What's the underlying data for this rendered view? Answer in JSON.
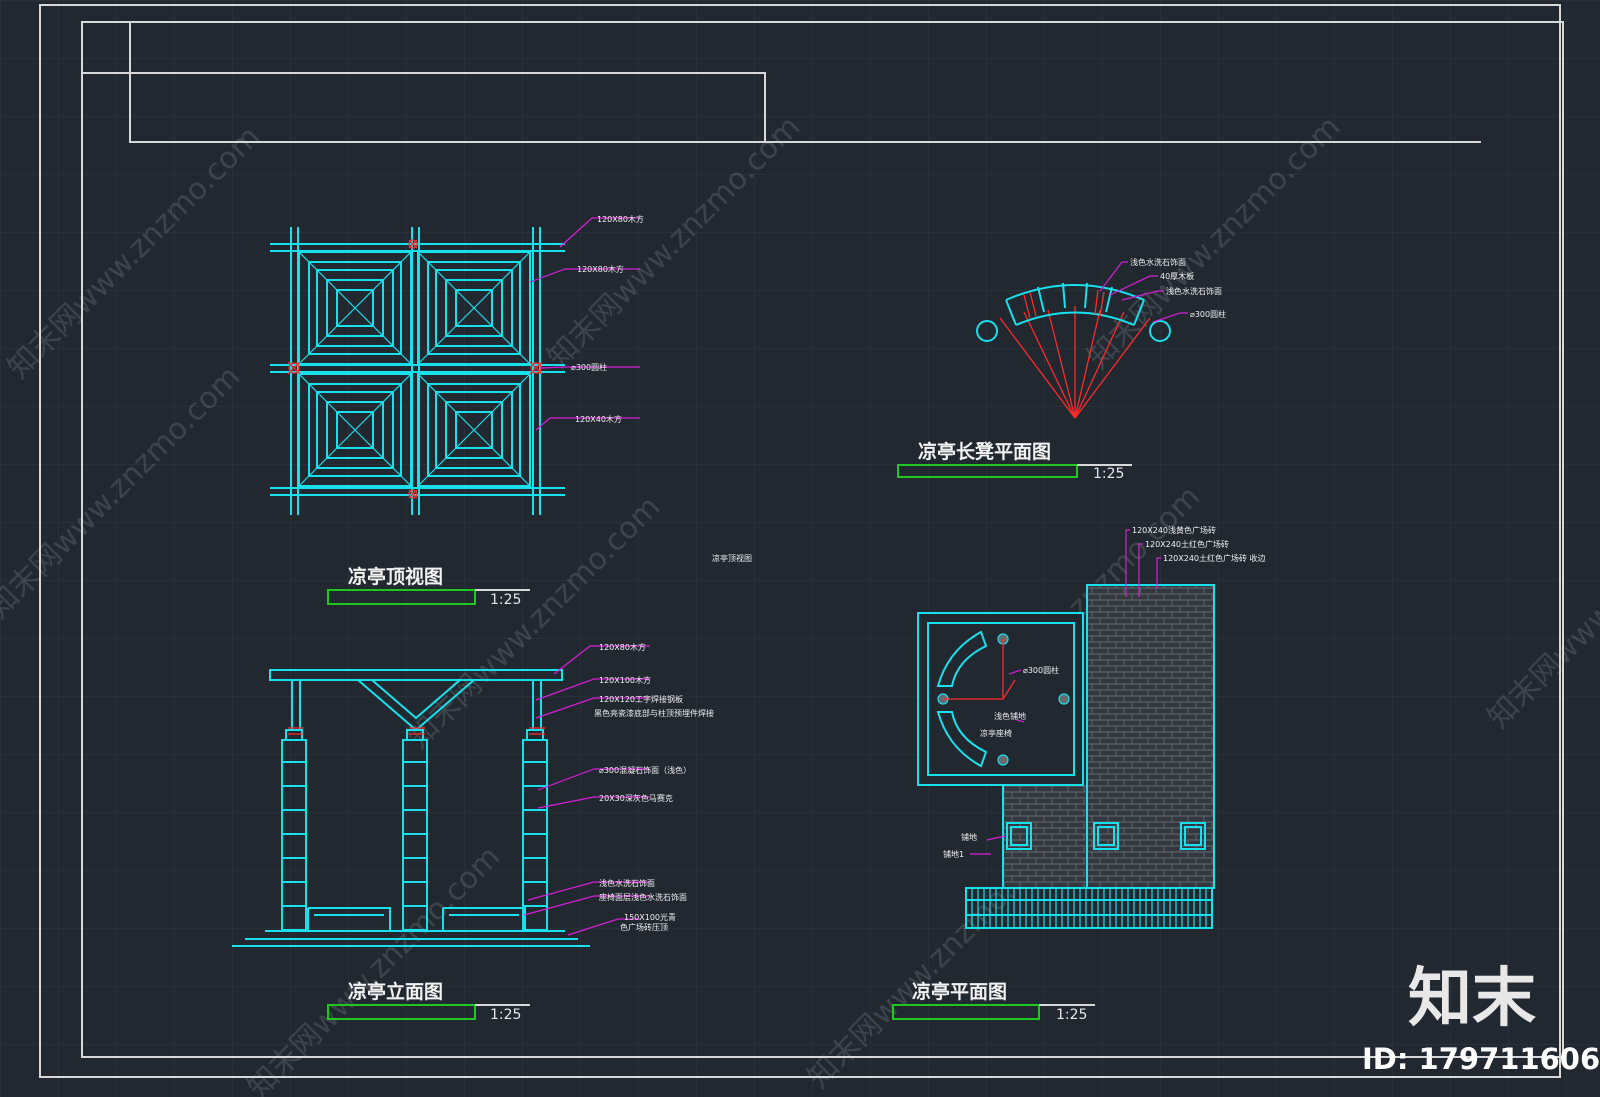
{
  "drawing": {
    "top_view": {
      "title": "凉亭顶视图",
      "scale": "1:25"
    },
    "bench_plan": {
      "title": "凉亭长凳平面图",
      "scale": "1:25"
    },
    "elevation": {
      "title": "凉亭立面图",
      "scale": "1:25"
    },
    "floor_plan": {
      "title": "凉亭平面图",
      "scale": "1:25"
    },
    "stray_label": "凉亭顶视图"
  },
  "annotations": {
    "top_view": [
      "120X80木方",
      "120X80木方",
      "⌀300圆柱",
      "120X40木方"
    ],
    "bench_plan": [
      "浅色水洗石饰面",
      "40厚木板",
      "浅色水洗石饰面",
      "⌀300圆柱"
    ],
    "elevation": [
      "120X80木方",
      "120X100木方",
      "120X120工字焊接钢板",
      "黑色亮瓷漆底部与柱顶预埋件焊接",
      "⌀300混凝石饰面（浅色）",
      "20X30深灰色马赛克",
      "浅色水洗石饰面",
      "座椅面层浅色水洗石饰面",
      "150X100光青",
      "色广场砖压顶"
    ],
    "floor_plan": [
      "120X240浅黄色广场砖",
      "120X240土红色广场砖",
      "120X240土红色广场砖 收边",
      "⌀300圆柱",
      "浅色铺地",
      "凉亭座椅",
      "铺地",
      "铺地1"
    ]
  },
  "brand": {
    "logo_text": "知末",
    "id_label": "ID: 179711606"
  },
  "watermarks": [
    "知末网www.znzmo.com",
    "知末网www.znzmo.com",
    "知末网www.znzmo.com",
    "知末网www.znzmo.com",
    "知末网www.znzmo.com",
    "知末网www.znzmo.com",
    "知末网www.znzmo.com",
    "知末网www.znzmo.com",
    "知末网www.znzmo.com"
  ],
  "colors": {
    "background": "#212830",
    "frame": "#d8d8d8",
    "cyan": "#18e0ec",
    "red": "#ff2a2a",
    "magenta": "#d81ed8",
    "green": "#1ec81e"
  }
}
